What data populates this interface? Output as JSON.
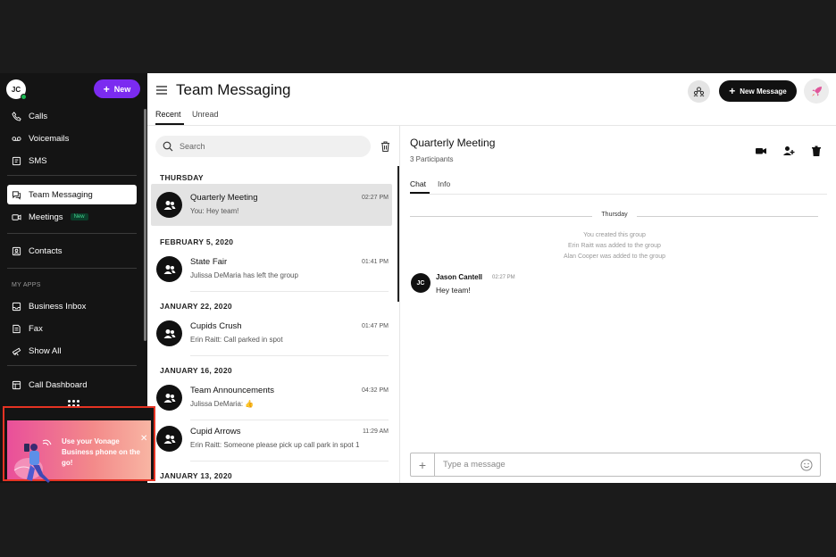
{
  "sidebar": {
    "user_initials": "JC",
    "new_button_label": "New",
    "items": [
      {
        "label": "Calls",
        "icon": "phone-icon"
      },
      {
        "label": "Voicemails",
        "icon": "voicemail-icon"
      },
      {
        "label": "SMS",
        "icon": "sms-icon"
      },
      {
        "label": "Team Messaging",
        "icon": "chat-icon",
        "active": true
      },
      {
        "label": "Meetings",
        "icon": "video-icon",
        "badge": "New"
      },
      {
        "label": "Contacts",
        "icon": "contacts-icon"
      },
      {
        "label": "Business Inbox",
        "icon": "inbox-icon"
      },
      {
        "label": "Fax",
        "icon": "fax-icon"
      },
      {
        "label": "Show All",
        "icon": "telescope-icon"
      },
      {
        "label": "Call Dashboard",
        "icon": "dashboard-icon"
      }
    ],
    "my_apps_label": "MY APPS",
    "promo": {
      "text": "Use your Vonage Business phone on the go!",
      "close": "✕"
    }
  },
  "header": {
    "title": "Team Messaging",
    "new_message_label": "New Message",
    "tabs": [
      {
        "label": "Recent",
        "active": true
      },
      {
        "label": "Unread"
      }
    ]
  },
  "list": {
    "search_placeholder": "Search",
    "groups": [
      {
        "date": "THURSDAY",
        "items": [
          {
            "name": "Quarterly Meeting",
            "time": "02:27 PM",
            "snippet": "You: Hey team!",
            "selected": true
          }
        ]
      },
      {
        "date": "FEBRUARY 5, 2020",
        "items": [
          {
            "name": "State Fair",
            "time": "01:41 PM",
            "snippet": "Julissa DeMaria has left the group"
          }
        ]
      },
      {
        "date": "JANUARY 22, 2020",
        "items": [
          {
            "name": "Cupids Crush",
            "time": "01:47 PM",
            "snippet": "Erin Raitt: Call parked in spot"
          }
        ]
      },
      {
        "date": "JANUARY 16, 2020",
        "items": [
          {
            "name": "Team Announcements",
            "time": "04:32 PM",
            "snippet": "Julissa DeMaria: 👍"
          },
          {
            "name": "Cupid Arrows",
            "time": "11:29 AM",
            "snippet": "Erin Raitt: Someone please pick up call park in spot 1"
          }
        ]
      },
      {
        "date": "JANUARY 13, 2020",
        "items": []
      }
    ]
  },
  "chat": {
    "title": "Quarterly Meeting",
    "participants": "3 Participants",
    "tabs": [
      {
        "label": "Chat",
        "active": true
      },
      {
        "label": "Info"
      }
    ],
    "day_label": "Thursday",
    "system_messages": [
      "You created this group",
      "Erin Raitt was added to the group",
      "Alan Cooper was added to the group"
    ],
    "message": {
      "initials": "JC",
      "sender": "Jason Cantell",
      "time": "02:27 PM",
      "text": "Hey team!"
    },
    "composer_placeholder": "Type a message"
  }
}
